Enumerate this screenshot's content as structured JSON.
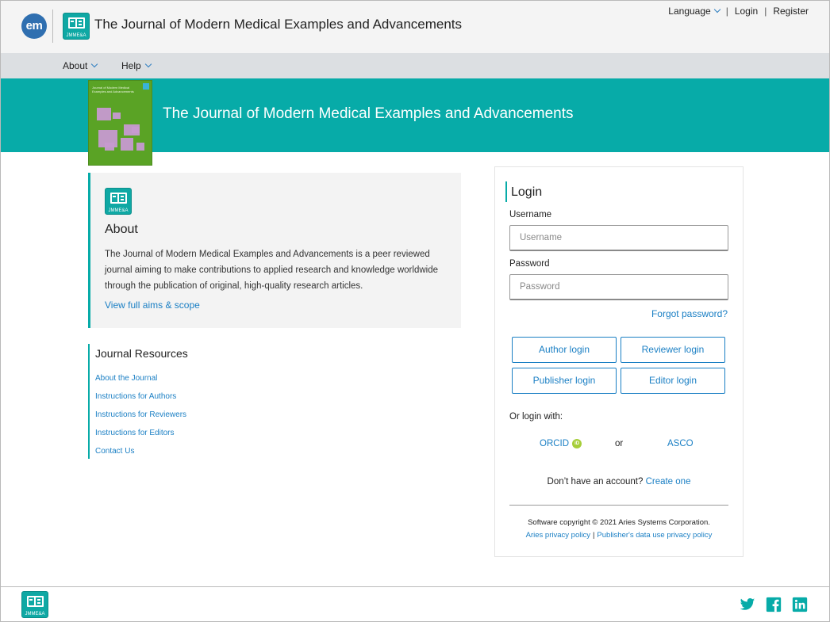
{
  "header": {
    "em_logo_text": "em",
    "journal_abbr": "JMME&A",
    "site_title": "The Journal of Modern Medical Examples and Advancements",
    "util_nav": {
      "language": "Language",
      "login": "Login",
      "register": "Register",
      "separator": "|"
    }
  },
  "navbar": {
    "items": [
      {
        "label": "About"
      },
      {
        "label": "Help"
      }
    ]
  },
  "banner": {
    "title": "The Journal of Modern Medical Examples and Advancements",
    "cover_small_text": "Journal of Modern Medical Examples and Advancements"
  },
  "about": {
    "logo_abbr": "JMME&A",
    "heading": "About",
    "description": "The Journal of Modern Medical Examples and Advancements is a peer reviewed journal aiming to make contributions to applied research and knowledge worldwide through the publication of original, high-quality research articles.",
    "link": "View full aims & scope"
  },
  "resources": {
    "heading": "Journal Resources",
    "links": [
      "About the Journal",
      "Instructions for Authors",
      "Instructions for Reviewers",
      "Instructions for Editors",
      "Contact Us"
    ]
  },
  "login": {
    "heading": "Login",
    "username_label": "Username",
    "username_placeholder": "Username",
    "password_label": "Password",
    "password_placeholder": "Password",
    "forgot": "Forgot password?",
    "buttons": {
      "author": "Author login",
      "reviewer": "Reviewer login",
      "publisher": "Publisher login",
      "editor": "Editor login"
    },
    "or_login_with": "Or login with:",
    "orcid": "ORCID",
    "orcid_badge": "iD",
    "or": "or",
    "asco": "ASCO",
    "no_account": "Don’t have an account?",
    "create_one": "Create one",
    "copyright": "Software copyright © 2021 Aries Systems Corporation.",
    "privacy_aries": "Aries privacy policy",
    "privacy_publisher": "Publisher's data use privacy policy",
    "pipe": "|"
  },
  "footer": {
    "logo_abbr": "JMME&A",
    "social": [
      "twitter-icon",
      "facebook-icon",
      "linkedin-icon"
    ]
  },
  "colors": {
    "accent_teal": "#07aba8",
    "link_blue": "#1a7fc4",
    "em_blue": "#2f6fb0",
    "cover_green": "#5aa325",
    "cover_squares": "#c79ad0",
    "orcid_green": "#a6ce39"
  }
}
